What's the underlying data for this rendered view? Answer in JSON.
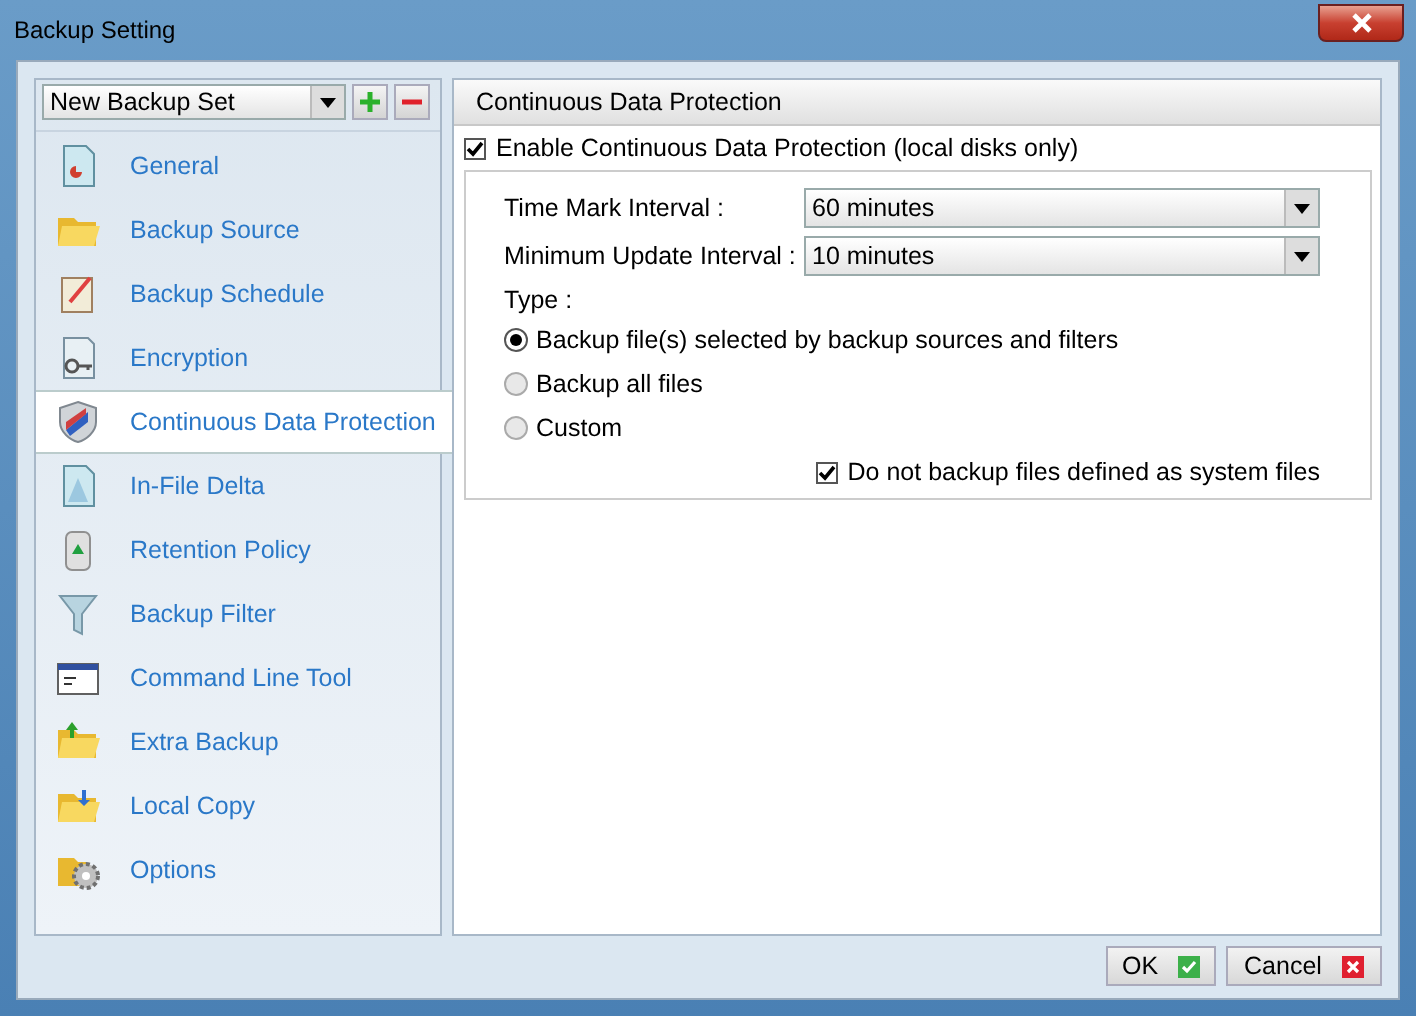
{
  "window": {
    "title": "Backup Setting"
  },
  "backup_set": {
    "value": "New Backup Set"
  },
  "sidebar": {
    "items": [
      {
        "label": "General",
        "selected": false
      },
      {
        "label": "Backup Source",
        "selected": false
      },
      {
        "label": "Backup Schedule",
        "selected": false
      },
      {
        "label": "Encryption",
        "selected": false
      },
      {
        "label": "Continuous Data Protection",
        "selected": true
      },
      {
        "label": "In-File Delta",
        "selected": false
      },
      {
        "label": "Retention Policy",
        "selected": false
      },
      {
        "label": "Backup Filter",
        "selected": false
      },
      {
        "label": "Command Line Tool",
        "selected": false
      },
      {
        "label": "Extra Backup",
        "selected": false
      },
      {
        "label": "Local Copy",
        "selected": false
      },
      {
        "label": "Options",
        "selected": false
      }
    ]
  },
  "panel": {
    "title": "Continuous Data Protection",
    "enable": {
      "label": "Enable Continuous Data Protection (local disks only)",
      "checked": true
    },
    "fields": [
      {
        "label": "Time Mark Interval :",
        "value": "60 minutes"
      },
      {
        "label": "Minimum Update Interval :",
        "value": "10 minutes"
      }
    ],
    "type_label": "Type :",
    "types": [
      {
        "label": "Backup file(s) selected by backup sources and filters",
        "selected": true
      },
      {
        "label": "Backup all files",
        "selected": false
      },
      {
        "label": "Custom",
        "selected": false
      }
    ],
    "system_files": {
      "label": "Do not backup files defined as system files",
      "checked": true
    }
  },
  "buttons": [
    {
      "label": "OK",
      "kind": "ok"
    },
    {
      "label": "Cancel",
      "kind": "cancel"
    }
  ]
}
